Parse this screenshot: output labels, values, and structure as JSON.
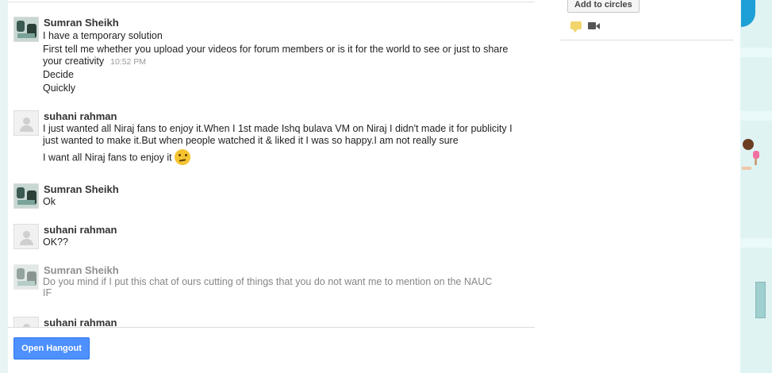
{
  "messages": [
    {
      "sender": "Sumran Sheikh",
      "avatar": "photo",
      "lines": [
        "I have a temporary solution",
        "First tell me whether you upload your videos for forum members or is it for the world to see or just to share",
        "your creativity",
        "Decide",
        "Quickly"
      ],
      "time": "10:52 PM"
    },
    {
      "sender": "suhani rahman",
      "avatar": "blank",
      "lines": [
        "I just wanted all Niraj fans to enjoy it.When I 1st made Ishq bulava VM on Niraj I didn't made it for publicity I",
        "just wanted to make it.But when people watched it & liked it I was so happy.I am not really sure",
        "I want all Niraj fans to enjoy it"
      ],
      "emoji": "confused-emoji"
    },
    {
      "sender": "Sumran Sheikh",
      "avatar": "photo",
      "lines": [
        "Ok"
      ]
    },
    {
      "sender": "suhani rahman",
      "avatar": "blank",
      "lines": [
        "OK??"
      ]
    },
    {
      "sender": "Sumran Sheikh",
      "avatar": "photo",
      "pending": true,
      "lines": [
        "Do you mind if I put this chat of ours cutting of things that you do not want me to mention on the NAUC",
        "IF"
      ]
    },
    {
      "sender": "suhani rahman",
      "avatar": "blank",
      "lines": []
    }
  ],
  "buttons": {
    "open_hangout": "Open Hangout",
    "add_to_circles": "Add to circles"
  },
  "icons": {
    "chat": "chat-bubble-icon",
    "video": "video-camera-icon"
  },
  "colors": {
    "primary_button": "#4d90fe",
    "background": "#eaf6f6"
  }
}
